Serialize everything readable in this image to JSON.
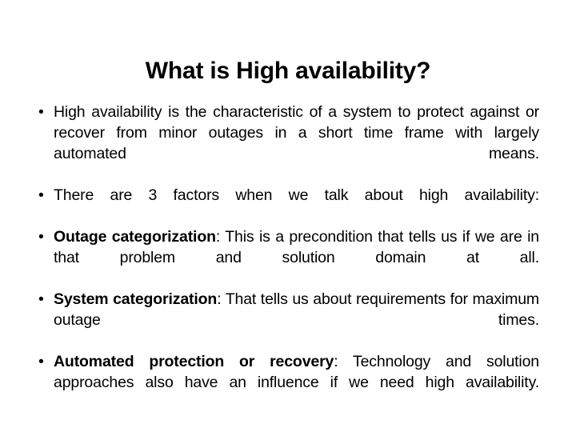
{
  "slide": {
    "title": "What is High availability?",
    "background_color": "#ffffff",
    "text_color": "#000000",
    "bullet_glyph": "•",
    "bullets": [
      {
        "lead": "",
        "separator": "",
        "text": "High availability is the characteristic of a system to protect against or recover from minor outages in a short time frame with largely automated means."
      },
      {
        "lead": "",
        "separator": "",
        "text": "There are 3 factors when we talk about high availability:"
      },
      {
        "lead": "Outage categorization",
        "separator": ": ",
        "text": "This is a precondition that tells us if we are in that problem and solution domain at all."
      },
      {
        "lead": "System categorization",
        "separator": ": ",
        "text": "That tells us about requirements for maximum outage times."
      },
      {
        "lead": "Automated protection or recovery",
        "separator": ": ",
        "text": "Technology and solution approaches also have an influence if we need high availability."
      }
    ]
  }
}
